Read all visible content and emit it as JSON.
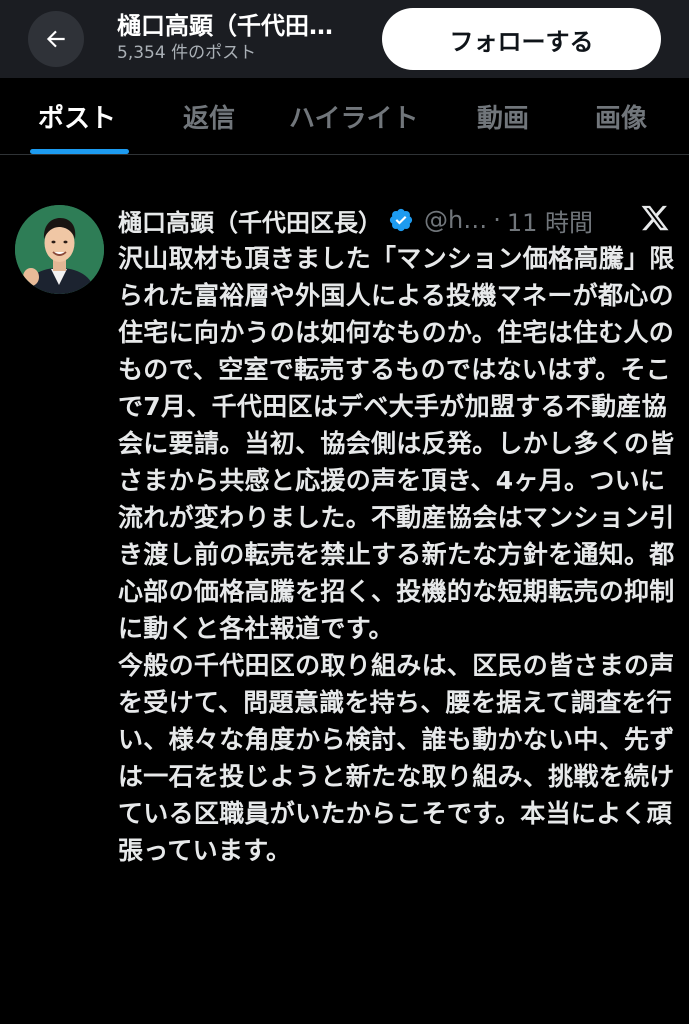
{
  "header": {
    "title": "樋口高顕（千代田…",
    "post_count": "5,354 件のポスト",
    "follow_label": "フォローする",
    "back_icon": "arrow-left-icon"
  },
  "tabs": [
    {
      "label": "ポスト",
      "active": true
    },
    {
      "label": "返信",
      "active": false
    },
    {
      "label": "ハイライト",
      "active": false
    },
    {
      "label": "動画",
      "active": false
    },
    {
      "label": "画像",
      "active": false
    }
  ],
  "colors": {
    "accent": "#1d9bf0",
    "background": "#000000",
    "header_bg": "#1b1d22",
    "muted_text": "#71767b",
    "primary_text": "#e7e9ea"
  },
  "post": {
    "author_name": "樋口高顕（千代田区長）",
    "verified_icon": "verified-badge-icon",
    "handle": "@h…",
    "separator": "·",
    "time": "11 時間",
    "platform_icon": "x-logo-icon",
    "text": "沢山取材も頂きました「マンション価格高騰」限られた富裕層や外国人による投機マネーが都心の住宅に向かうのは如何なものか。住宅は住む人のもので、空室で転売するものではないはず。そこで7月、千代田区はデベ大手が加盟する不動産協会に要請。当初、協会側は反発。しかし多くの皆さまから共感と応援の声を頂き、4ヶ月。ついに流れが変わりました。不動産協会はマンション引き渡し前の転売を禁止する新たな方針を通知。都心部の価格高騰を招く、投機的な短期転売の抑制に動くと各社報道です。\n今般の千代田区の取り組みは、区民の皆さまの声を受けて、問題意識を持ち、腰を据えて調査を行い、様々な角度から検討、誰も動かない中、先ずは一石を投じようと新たな取り組み、挑戦を続けている区職員がいたからこそです。本当によく頑張っています。"
  }
}
